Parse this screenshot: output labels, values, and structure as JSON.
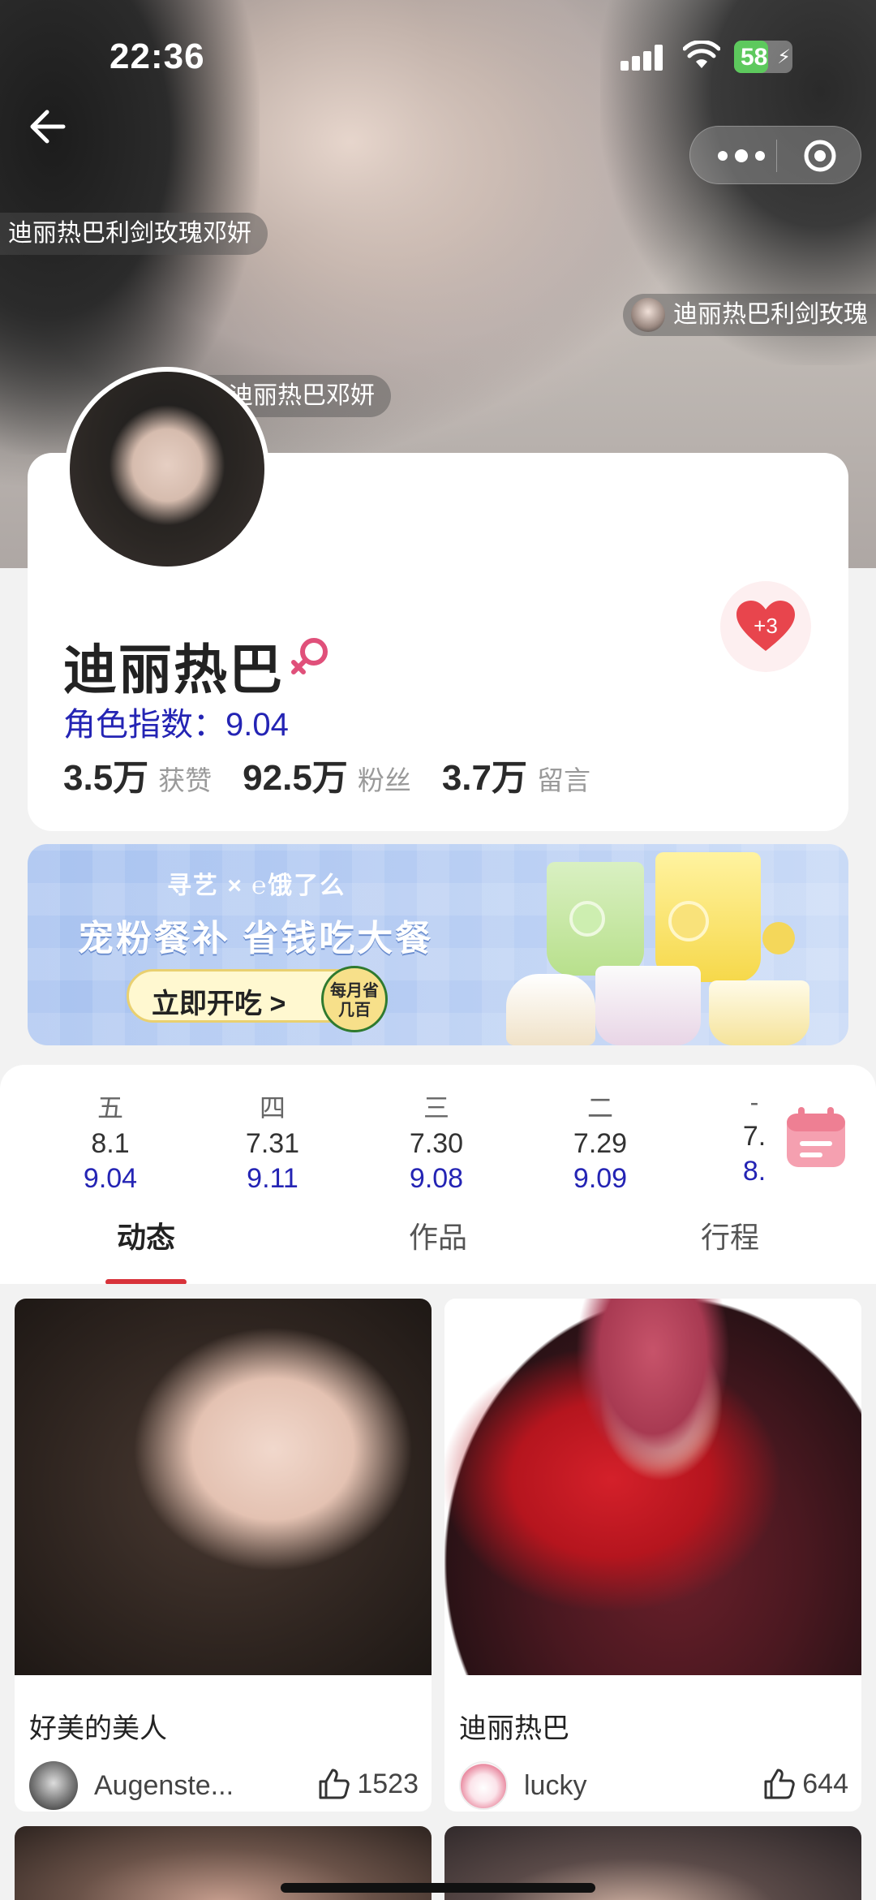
{
  "status_bar": {
    "time": "22:36",
    "battery": "58",
    "battery_level_pct": 58
  },
  "danmaku": [
    {
      "text": "迪丽热巴利剑玫瑰邓妍"
    },
    {
      "text": "迪丽热巴利剑玫瑰"
    },
    {
      "text": "迪丽热巴邓妍"
    }
  ],
  "profile": {
    "name": "迪丽热巴",
    "index_label": "角色指数：9.04",
    "stats": [
      {
        "value": "3.5万",
        "label": "获赞"
      },
      {
        "value": "92.5万",
        "label": "粉丝"
      },
      {
        "value": "3.7万",
        "label": "留言"
      }
    ],
    "support_badge": "+3"
  },
  "banner": {
    "brand": "寻艺 × ℮饿了么",
    "title": "宠粉餐补 省钱吃大餐",
    "button": "立即开吃 >",
    "badge": "每月省几百"
  },
  "calendar": [
    {
      "weekday": "五",
      "date": "8.1",
      "score": "9.04"
    },
    {
      "weekday": "四",
      "date": "7.31",
      "score": "9.11"
    },
    {
      "weekday": "三",
      "date": "7.30",
      "score": "9.08"
    },
    {
      "weekday": "二",
      "date": "7.29",
      "score": "9.09"
    },
    {
      "weekday": "-",
      "date": "7.",
      "score": "8."
    }
  ],
  "tabs": [
    {
      "label": "动态"
    },
    {
      "label": "作品"
    },
    {
      "label": "行程"
    }
  ],
  "posts": [
    {
      "title": "好美的美人",
      "author": "Augenste...",
      "likes": "1523"
    },
    {
      "title": "迪丽热巴",
      "author": "lucky",
      "likes": "644"
    }
  ],
  "colors": {
    "accent_red": "#d8323a",
    "index_blue": "#2424b4"
  }
}
